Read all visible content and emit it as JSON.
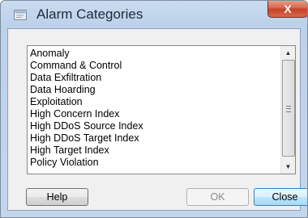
{
  "window": {
    "title": "Alarm Categories",
    "close_glyph": "X"
  },
  "list": {
    "items": [
      "Anomaly",
      "Command & Control",
      "Data Exfiltration",
      "Data Hoarding",
      "Exploitation",
      "High Concern Index",
      "High DDoS Source Index",
      "High DDoS Target Index",
      "High Target Index",
      "Policy Violation"
    ]
  },
  "scrollbar": {
    "up_glyph": "▲",
    "down_glyph": "▼"
  },
  "buttons": {
    "help": "Help",
    "ok": "OK",
    "close": "Close"
  }
}
